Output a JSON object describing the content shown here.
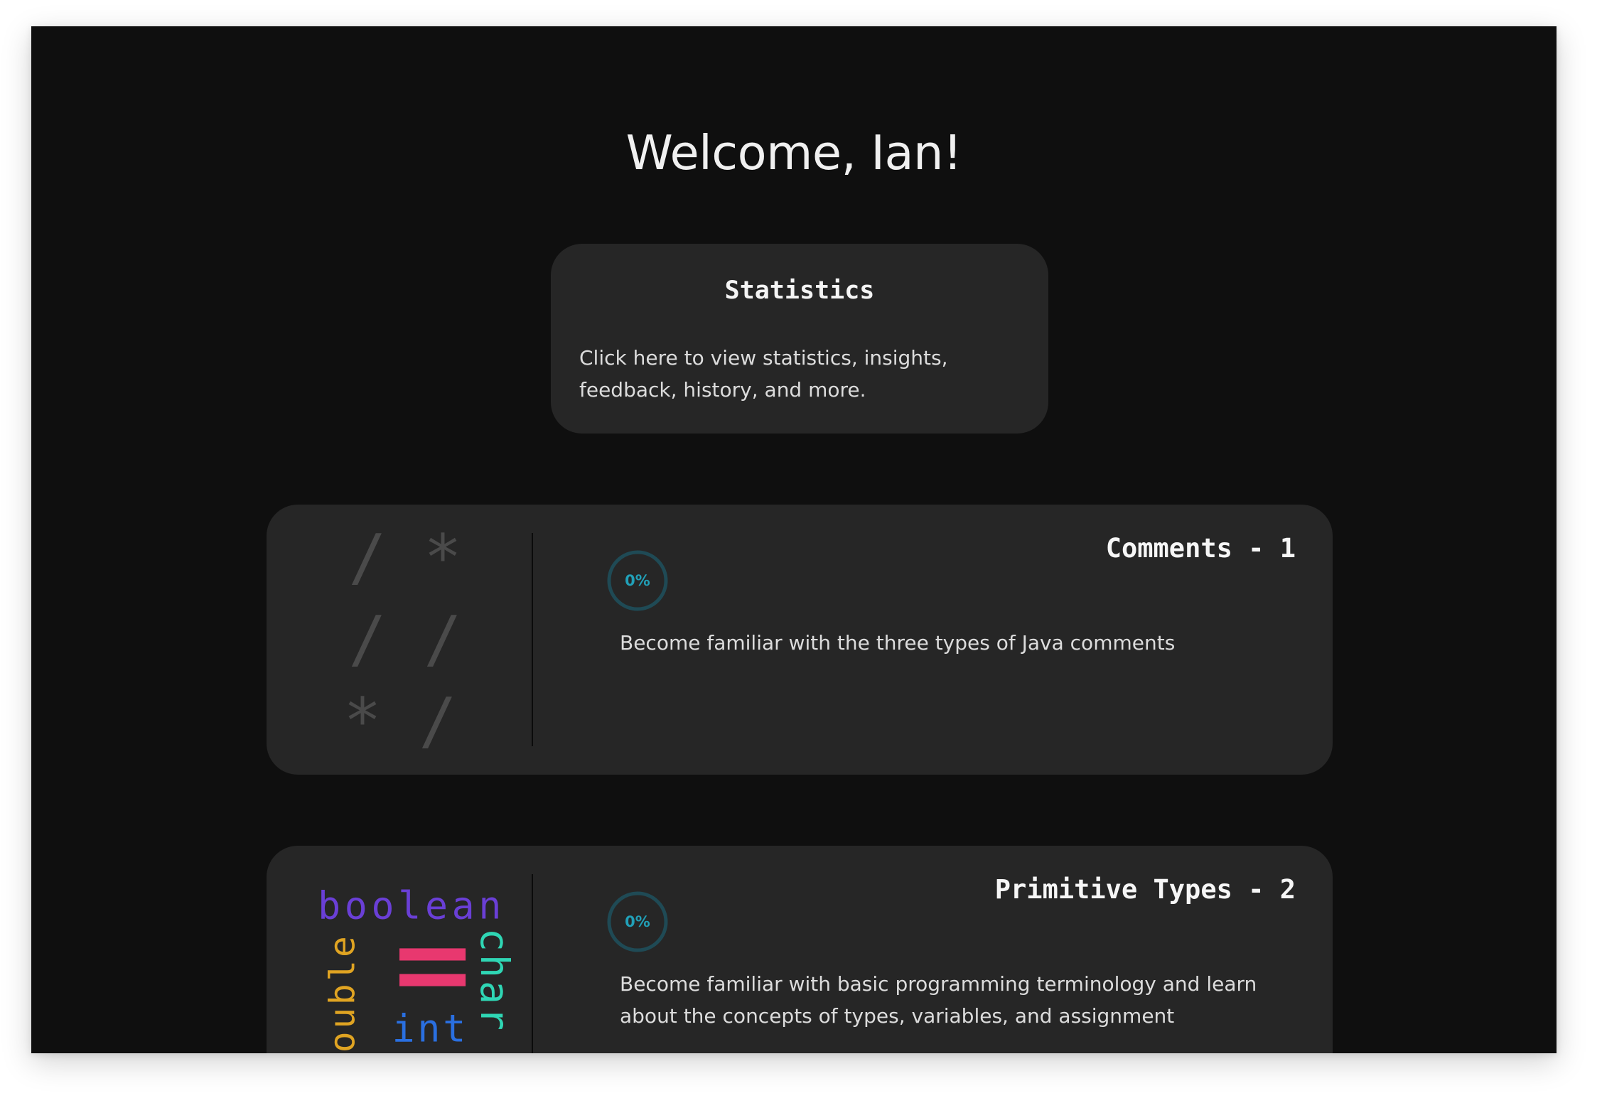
{
  "header": {
    "welcome": "Welcome, Ian!"
  },
  "statistics": {
    "title": "Statistics",
    "description": "Click here to view statistics, insights, feedback, history, and more."
  },
  "lessons": [
    {
      "title": "Comments - 1",
      "progress_label": "0%",
      "progress": 0,
      "description": "Become familiar with the three types of Java comments",
      "art": {
        "lines": [
          "/ *",
          "/ /",
          "* /"
        ],
        "color": "#4a4a4a"
      }
    },
    {
      "title": "Primitive Types - 2",
      "progress_label": "0%",
      "progress": 0,
      "description": "Become familiar with basic programming terminology and learn about the concepts of types, variables, and assignment",
      "art": {
        "words": {
          "boolean": "boolean",
          "double": "double",
          "char": "char",
          "int": "int"
        },
        "colors": {
          "boolean": "#6a3fd6",
          "double": "#e0a422",
          "char": "#2fd6b4",
          "int": "#2a6fe0",
          "equals": "#e8386f"
        }
      }
    }
  ],
  "colors": {
    "background": "#0f0f0f",
    "card": "#262626",
    "accent": "#21a0b8",
    "ring_track": "#1f4a55"
  }
}
